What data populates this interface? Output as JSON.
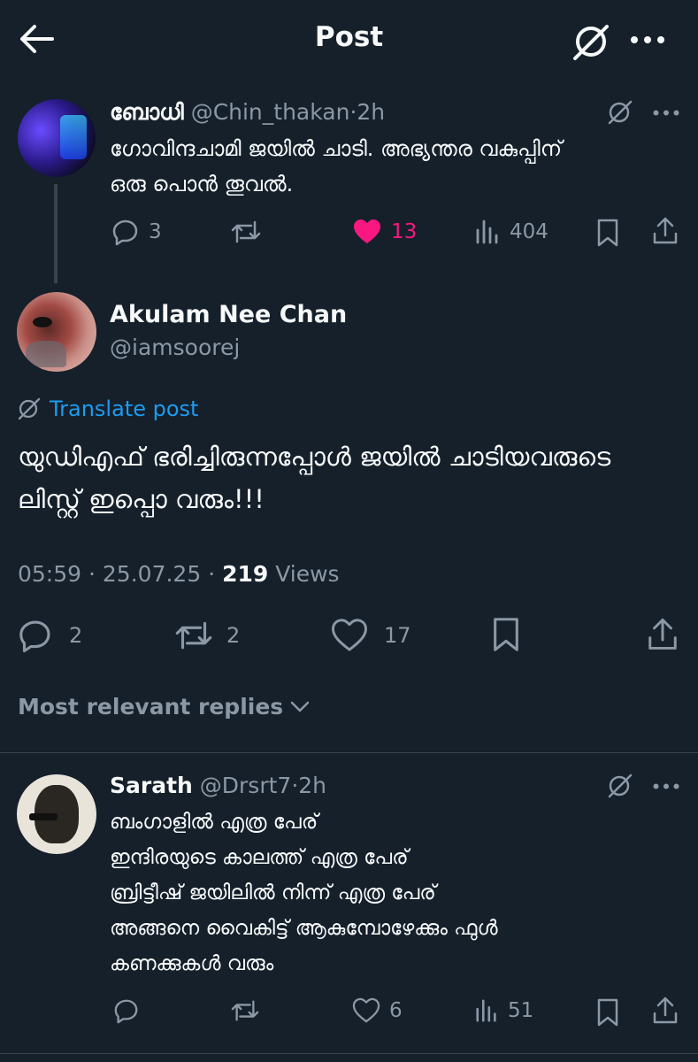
{
  "header": {
    "title": "Post"
  },
  "parent_post": {
    "name": "ബോധി",
    "handle": "@Chin_thakan",
    "time": "2h",
    "text_lines": [
      "ഗോവിന്ദചാമി ജയിൽ ചാടി. അഭ്യന്തര വകുപ്പിന്",
      "ഒരു പൊൻ തൂവൽ."
    ],
    "replies": "3",
    "likes": "13",
    "views": "404",
    "liked": true
  },
  "main_post": {
    "name": "Akulam Nee Chan",
    "handle": "@iamsoorej",
    "translate": "Translate post",
    "text_lines": [
      "യുഡിഎഫ് ഭരിച്ചിരുന്നപ്പോൾ ജയിൽ ചാടിയവരുടെ",
      "ലിസ്റ്റ് ഇപ്പൊ വരും!!!"
    ],
    "time": "05:59",
    "date": "25.07.25",
    "views_count": "219",
    "views_label": "Views",
    "replies": "2",
    "reposts": "2",
    "likes": "17"
  },
  "sort": {
    "label": "Most relevant replies"
  },
  "reply": {
    "name": "Sarath",
    "handle": "@Drsrt7",
    "time": "2h",
    "text_lines": [
      "ബംഗാളിൽ എത്ര പേര്",
      "ഇന്ദിരയുടെ കാലത്ത് എത്ര പേര്",
      "ബ്രിട്ടീഷ് ജയിലിൽ നിന്ന് എത്ര പേര്",
      "അങ്ങനെ വൈകിട്ട് ആകുമ്പോഴേക്കും ഫുൾ",
      "കണക്കുകൾ വരും"
    ],
    "likes": "6",
    "views": "51"
  },
  "colors": {
    "background": "#15202b",
    "accent": "#1d9bf0",
    "like": "#f91880",
    "muted": "#8b98a5"
  }
}
